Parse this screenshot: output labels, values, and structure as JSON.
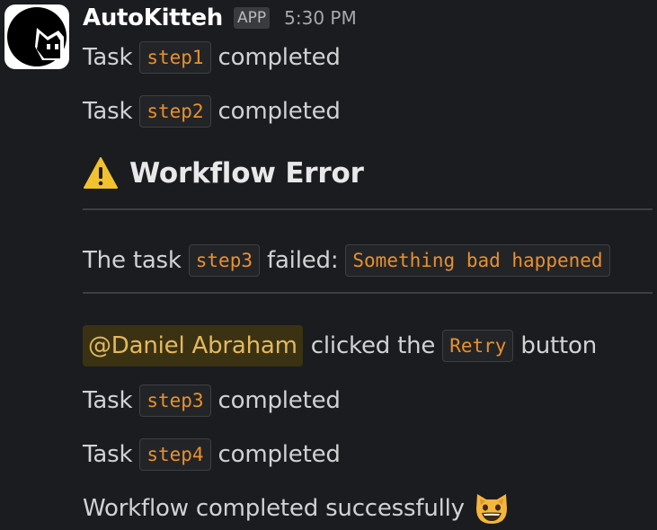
{
  "message": {
    "sender": "AutoKitteh",
    "badge": "APP",
    "time": "5:30 PM"
  },
  "lines": {
    "l1": {
      "pre": "Task",
      "code": "step1",
      "post": "completed"
    },
    "l2": {
      "pre": "Task",
      "code": "step2",
      "post": "completed"
    },
    "error_title": "Workflow Error",
    "error": {
      "pre": "The task",
      "code": "step3",
      "mid": "failed:",
      "code2": "Something bad happened"
    },
    "click": {
      "mention": "@Daniel Abraham",
      "pre": "clicked the",
      "code": "Retry",
      "post": "button"
    },
    "l3": {
      "pre": "Task",
      "code": "step3",
      "post": "completed"
    },
    "l4": {
      "pre": "Task",
      "code": "step4",
      "post": "completed"
    },
    "final": "Workflow completed successfully"
  },
  "icons": {
    "avatar": "black-cat-icon",
    "warning": "warning-icon",
    "emoji": "grinning-cat-emoji-icon"
  },
  "colors": {
    "background": "#1b1c1f",
    "text": "#d1d2d3",
    "code": "#e8912d",
    "mention_bg": "#3b3214",
    "mention_text": "#e4b95b",
    "warning": "#f2c12e"
  }
}
